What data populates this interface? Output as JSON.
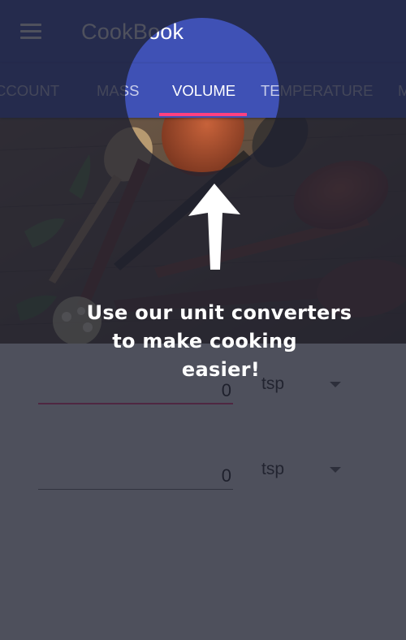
{
  "app_bar": {
    "title": "CookBook",
    "menu_icon": "menu-icon",
    "color": "#3f51b5"
  },
  "tabs": {
    "items": [
      {
        "label": "CCOUNT"
      },
      {
        "label": "MASS"
      },
      {
        "label": "VOLUME",
        "selected": true
      },
      {
        "label": "TEMPERATURE"
      },
      {
        "label": "M"
      }
    ],
    "indicator_color": "#ff4081"
  },
  "converter": {
    "from": {
      "value": "0",
      "unit": "tsp"
    },
    "to": {
      "value": "0",
      "unit": "tsp"
    }
  },
  "tutorial": {
    "lines": [
      "Use our unit converters",
      "to make cooking",
      "easier!"
    ],
    "arrow_icon": "arrow-up-icon",
    "scrim_color": "#1e2030"
  }
}
